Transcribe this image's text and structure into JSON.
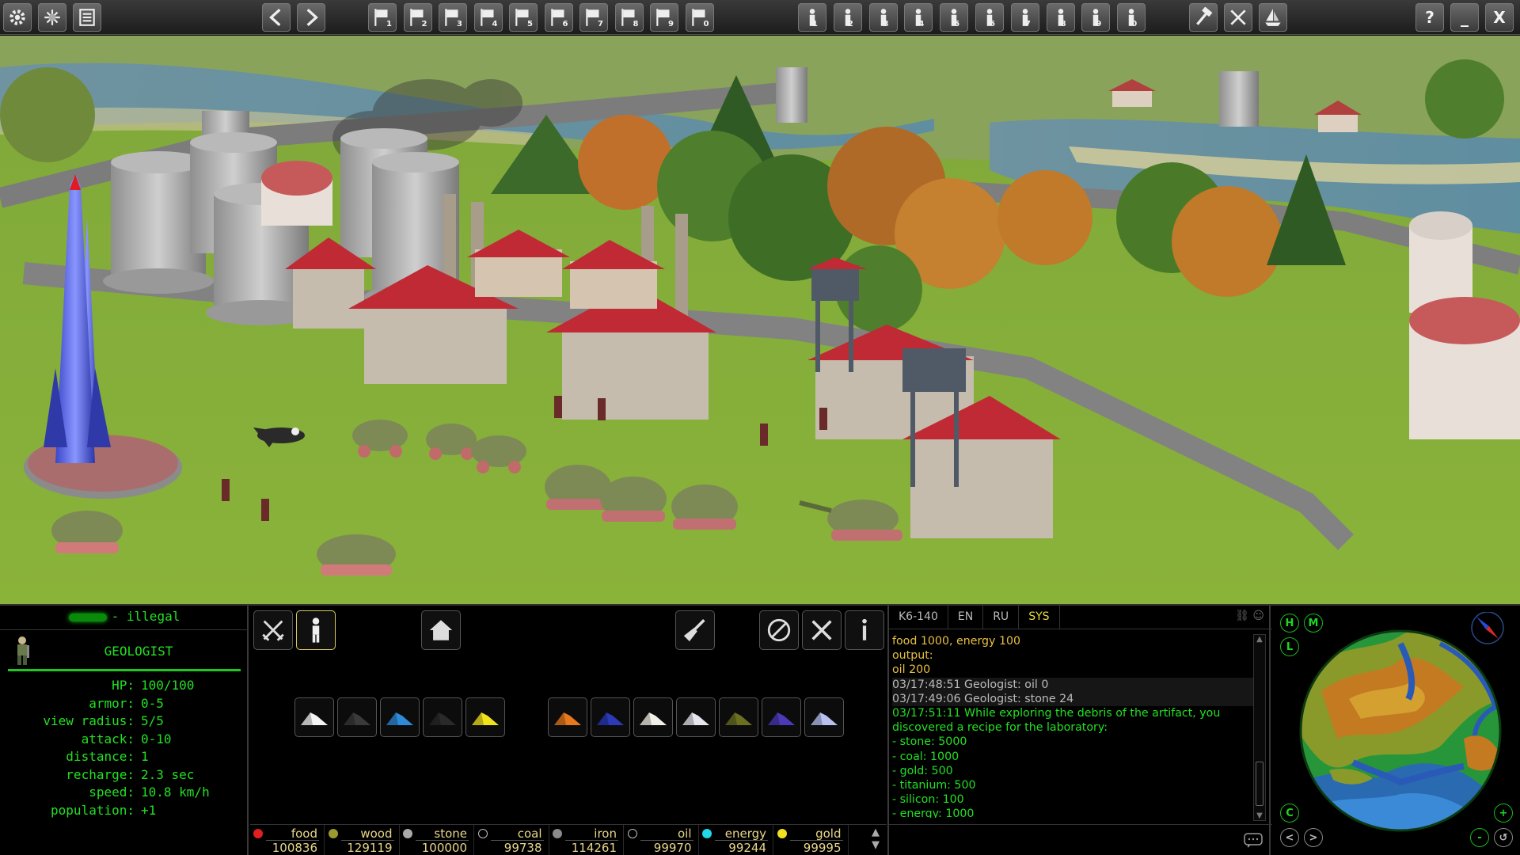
{
  "topbar": {
    "left_icons": [
      "gear-icon",
      "sparkle-icon",
      "list-icon"
    ],
    "nav": [
      "chevron-left-icon",
      "chevron-right-icon"
    ],
    "groups": [
      "1",
      "2",
      "3",
      "4",
      "5",
      "6",
      "7",
      "8",
      "9",
      "0"
    ],
    "squads": [
      "1",
      "2",
      "3",
      "4",
      "5",
      "6",
      "7",
      "8",
      "9",
      "0"
    ],
    "tools": [
      "hammer-icon",
      "swords-icon",
      "ship-icon"
    ],
    "window": [
      "?",
      "_",
      "X"
    ]
  },
  "unit": {
    "owner": "- illegal",
    "name": "GEOLOGIST",
    "stats": [
      {
        "k": "HP:",
        "v": "100/100"
      },
      {
        "k": "armor:",
        "v": "0-5"
      },
      {
        "k": "view radius:",
        "v": "5/5"
      },
      {
        "k": "attack:",
        "v": "0-10"
      },
      {
        "k": "distance:",
        "v": "1"
      },
      {
        "k": "recharge:",
        "v": "2.3 sec"
      },
      {
        "k": "speed:",
        "v": "10.8 km/h"
      },
      {
        "k": "population:",
        "v": "+1"
      }
    ]
  },
  "materials_left": [
    {
      "color": "#f3f3f3"
    },
    {
      "color": "#3a3a3a"
    },
    {
      "color": "#2f8ad8"
    },
    {
      "color": "#2a2a2a"
    },
    {
      "color": "#f2e21c"
    }
  ],
  "materials_right": [
    {
      "color": "#e8781c"
    },
    {
      "color": "#2a3ab8"
    },
    {
      "color": "#f2efe6"
    },
    {
      "color": "#e6e6ee"
    },
    {
      "color": "#6a7020"
    },
    {
      "color": "#4a3ab8"
    },
    {
      "color": "#b8c0f0"
    }
  ],
  "resources": [
    {
      "name": "food",
      "qty": "100836",
      "dot": "#e02020",
      "hollow": false
    },
    {
      "name": "wood",
      "qty": "129119",
      "dot": "#9a9a30",
      "hollow": false
    },
    {
      "name": "stone",
      "qty": "100000",
      "dot": "#aaaaaa",
      "hollow": false
    },
    {
      "name": "coal",
      "qty": "99738",
      "dot": "#000000",
      "hollow": true
    },
    {
      "name": "iron",
      "qty": "114261",
      "dot": "#8a8a8a",
      "hollow": false
    },
    {
      "name": "oil",
      "qty": "99970",
      "dot": "#000000",
      "hollow": true
    },
    {
      "name": "energy",
      "qty": "99244",
      "dot": "#20d8e8",
      "hollow": false
    },
    {
      "name": "gold",
      "qty": "99995",
      "dot": "#f0e020",
      "hollow": false
    }
  ],
  "chat": {
    "tabs": [
      "K6-140",
      "EN",
      "RU",
      "SYS"
    ],
    "active_tab": "SYS",
    "lines": [
      {
        "t": "food 1000, energy 100",
        "c": "c-yo"
      },
      {
        "t": "output:",
        "c": "c-yo"
      },
      {
        "t": "oil 200",
        "c": "c-yo"
      },
      {
        "t": "03/17:48:51 Geologist: oil 0",
        "c": "c-w"
      },
      {
        "t": "03/17:49:06 Geologist: stone 24",
        "c": "c-w"
      },
      {
        "t": "03/17:51:11 While exploring the debris of the artifact, you",
        "c": "c-g"
      },
      {
        "t": "discovered a recipe for the laboratory:",
        "c": "c-g"
      },
      {
        "t": "- stone: 5000",
        "c": "c-g"
      },
      {
        "t": "- coal: 1000",
        "c": "c-g"
      },
      {
        "t": "- gold: 500",
        "c": "c-g"
      },
      {
        "t": "- titanium: 500",
        "c": "c-g"
      },
      {
        "t": "- silicon: 100",
        "c": "c-g"
      },
      {
        "t": "- energy: 1000",
        "c": "c-g"
      }
    ]
  },
  "minimap": {
    "buttons": [
      "H",
      "M",
      "L",
      "C",
      "+",
      "-"
    ]
  }
}
